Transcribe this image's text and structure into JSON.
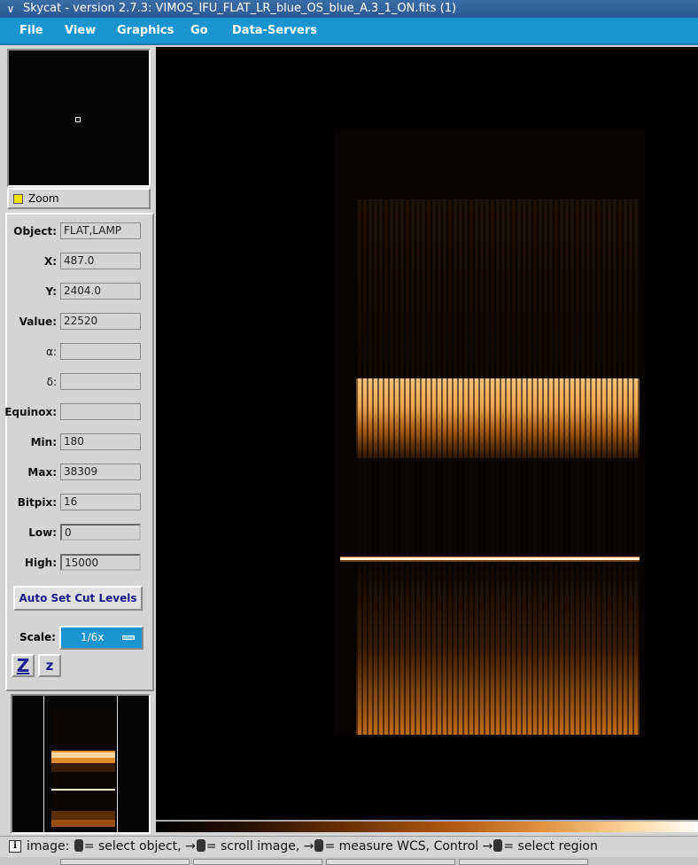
{
  "window": {
    "title": "Skycat - version 2.7.3: VIMOS_IFU_FLAT_LR_blue_OS_blue_A.3_1_ON.fits (1)"
  },
  "menu": [
    "File",
    "View",
    "Graphics",
    "Go",
    "Data-Servers"
  ],
  "zoom_toggle": {
    "label": "Zoom",
    "checked": true
  },
  "fields": [
    {
      "label": "Object:",
      "value": "FLAT,LAMP"
    },
    {
      "label": "X:",
      "value": "487.0"
    },
    {
      "label": "Y:",
      "value": "2404.0"
    },
    {
      "label": "Value:",
      "value": "22520"
    },
    {
      "label": "α:",
      "value": ""
    },
    {
      "label": "δ:",
      "value": ""
    },
    {
      "label": "Equinox:",
      "value": ""
    },
    {
      "label": "Min:",
      "value": "180"
    },
    {
      "label": "Max:",
      "value": "38309"
    },
    {
      "label": "Bitpix:",
      "value": "16"
    },
    {
      "label": "Low:",
      "value": "0"
    },
    {
      "label": "High:",
      "value": "15000"
    }
  ],
  "buttons": {
    "auto_cut": "Auto Set Cut Levels",
    "zoom_in": "Z",
    "zoom_out": "z"
  },
  "scale": {
    "label": "Scale:",
    "value": "1/6x"
  },
  "status": {
    "prefix": "image:",
    "part1": "= select object,",
    "part2": "= scroll image,",
    "part3": "= measure WCS, Control",
    "part4": "= select region"
  },
  "colors": {
    "menu_bg": "#1b95cf",
    "title_bg": "#3a6ea5",
    "flat_orange": "#e08a30"
  }
}
